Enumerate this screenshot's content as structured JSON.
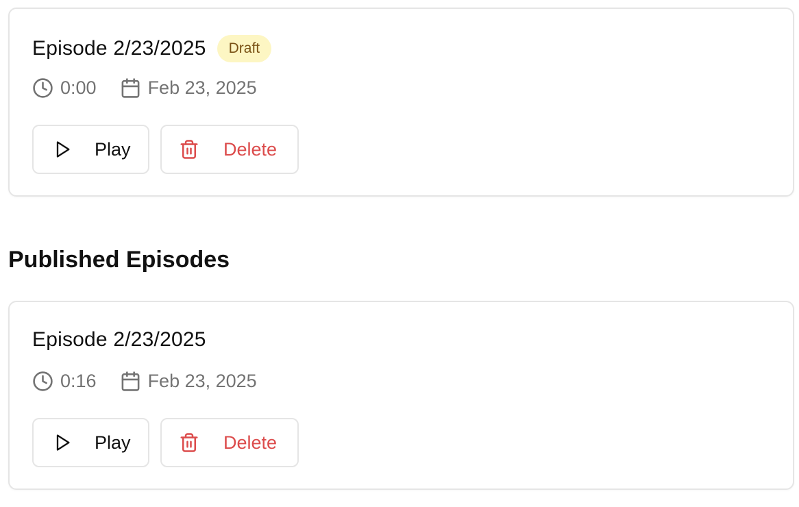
{
  "draft_episode": {
    "title": "Episode 2/23/2025",
    "badge": "Draft",
    "duration": "0:00",
    "date": "Feb 23, 2025",
    "play_label": "Play",
    "delete_label": "Delete"
  },
  "published_section": {
    "title": "Published Episodes"
  },
  "published_episodes": [
    {
      "title": "Episode 2/23/2025",
      "duration": "0:16",
      "date": "Feb 23, 2025",
      "play_label": "Play",
      "delete_label": "Delete"
    }
  ],
  "icons": {
    "clock": "clock-icon",
    "calendar": "calendar-icon",
    "play": "play-icon",
    "trash": "trash-icon"
  },
  "colors": {
    "badge_bg": "#fdf6c3",
    "badge_text": "#7a5215",
    "delete": "#dc4c4c",
    "muted_text": "#737373",
    "border": "#e5e5e5"
  }
}
